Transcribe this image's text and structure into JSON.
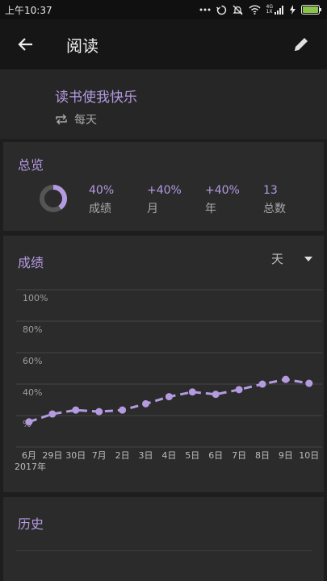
{
  "status_bar": {
    "time": "上午10:37",
    "network": "4G",
    "network_sub": "1X"
  },
  "appbar": {
    "title": "阅读"
  },
  "habit": {
    "name": "读书使我快乐",
    "frequency": "每天"
  },
  "overview": {
    "title": "总览",
    "ring_fraction": 0.4,
    "stats": [
      {
        "value": "40%",
        "label": "成绩"
      },
      {
        "value": "+40%",
        "label": "月"
      },
      {
        "value": "+40%",
        "label": "年"
      },
      {
        "value": "13",
        "label": "总数"
      }
    ]
  },
  "score": {
    "title": "成绩",
    "range_selected": "天"
  },
  "chart_data": {
    "type": "line",
    "y_tick_labels": [
      "100%",
      "80%",
      "60%",
      "40%",
      "%"
    ],
    "x_tick_labels": [
      "6月",
      "29日",
      "30日",
      "7月",
      "2日",
      "3日",
      "4日",
      "5日",
      "6日",
      "7日",
      "8日",
      "9日",
      "10日"
    ],
    "x_year_label": "2017年",
    "values": [
      16,
      21,
      23.5,
      22.5,
      23.5,
      27.5,
      32,
      35,
      33.5,
      36.5,
      40,
      43,
      40.5
    ],
    "ylim": [
      0,
      100
    ],
    "grid": true,
    "colors": {
      "line": "#b49ae0",
      "grid": "#444444"
    }
  },
  "history": {
    "title": "历史"
  },
  "colors": {
    "accent": "#b49ae0",
    "card": "#2b2b2b",
    "background": "#1e1e1e"
  }
}
